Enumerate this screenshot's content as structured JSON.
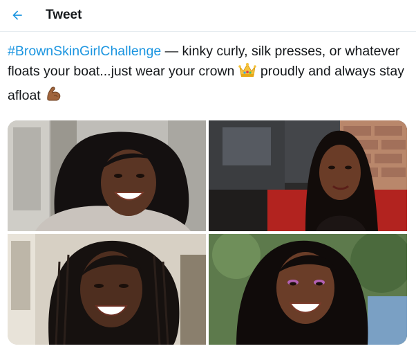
{
  "header": {
    "title": "Tweet",
    "back_icon": "arrow-left-icon"
  },
  "tweet": {
    "hashtag": "#BrownSkinGirlChallenge",
    "text_1": " — kinky curly, silk presses, or whatever floats your boat...just wear your crown",
    "text_2": "proudly and always stay afloat",
    "emoji_1": "crown-emoji",
    "emoji_2": "flexed-biceps-emoji"
  },
  "media": {
    "photos": [
      {
        "icon": "photo-smiling-woman-natural-curly-hair"
      },
      {
        "icon": "photo-woman-long-straight-hair-red-booth"
      },
      {
        "icon": "photo-smiling-woman-braided-locs"
      },
      {
        "icon": "photo-smiling-woman-long-wavy-hair-outdoors"
      }
    ]
  },
  "colors": {
    "accent": "#1b95e0",
    "text": "#14171a",
    "border": "#e6ecf0"
  }
}
